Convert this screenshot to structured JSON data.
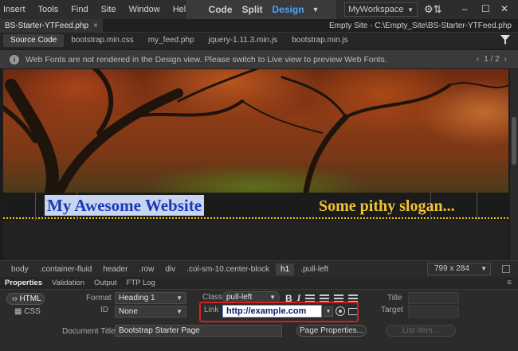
{
  "menubar": {
    "items": [
      "Insert",
      "Tools",
      "Find",
      "Site",
      "Window",
      "Help"
    ],
    "view_modes": [
      "Code",
      "Split",
      "Design"
    ],
    "active_mode": "Design",
    "workspace": "MyWorkspace"
  },
  "tabbar": {
    "doc_tab": "BS-Starter-YTFeed.php",
    "site_path": "Empty Site - C:\\Empty_Site\\BS-Starter-YTFeed.php"
  },
  "related_files": [
    "Source Code",
    "bootstrap.min.css",
    "my_feed.php",
    "jquery-1.11.3.min.js",
    "bootstrap.min.js"
  ],
  "infobar": {
    "message": "Web Fonts are not rendered in the Design view. Please switch to Live view to preview Web Fonts.",
    "pager": "1 / 2"
  },
  "design_view": {
    "site_title": "My Awesome Website",
    "slogan": "Some pithy slogan..."
  },
  "tag_selector": {
    "tags": [
      "body",
      ".container-fluid",
      "header",
      ".row",
      "div",
      ".col-sm-10.center-block",
      "h1",
      ".pull-left"
    ],
    "active_tag": "h1",
    "dimensions": "799 x 284"
  },
  "properties": {
    "tabs": [
      "Properties",
      "Validation",
      "Output",
      "FTP Log"
    ],
    "html_button": "HTML",
    "css_button": "CSS",
    "format_label": "Format",
    "format_value": "Heading 1",
    "id_label": "ID",
    "id_value": "None",
    "class_label": "Class",
    "class_value": "pull-left",
    "link_label": "Link",
    "link_value": "http://example.com",
    "title_label": "Title",
    "target_label": "Target",
    "doc_title_label": "Document Title",
    "doc_title_value": "Bootstrap Starter Page",
    "page_properties_button": "Page Properties...",
    "list_item_button": "List Item..."
  },
  "colors": {
    "accent": "#4aa3ff",
    "title_text": "#1a3ab8",
    "slogan": "#f1c232",
    "highlight_box": "#d61f1f"
  }
}
